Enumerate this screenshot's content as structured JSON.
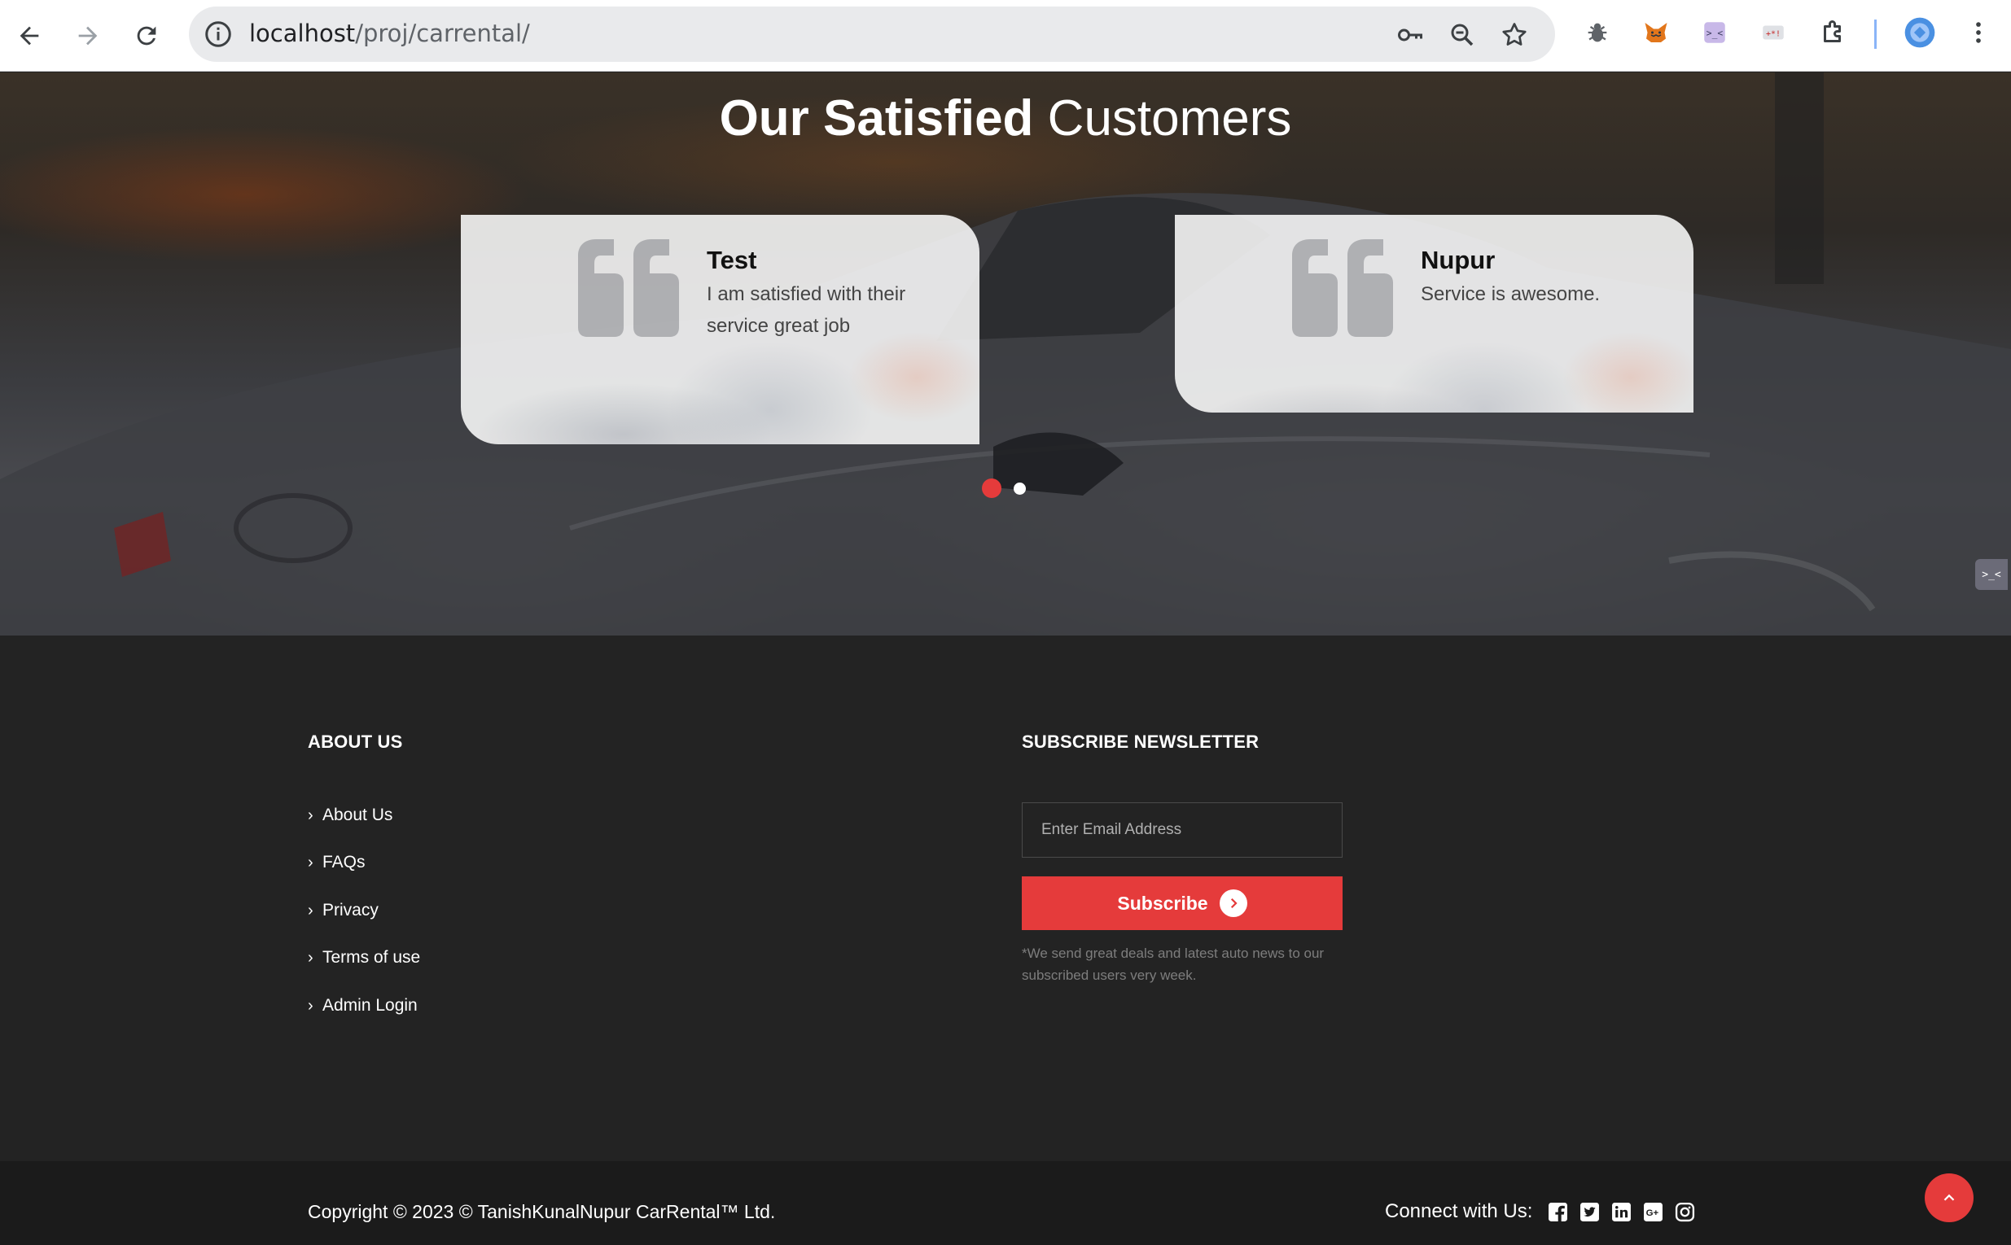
{
  "browser": {
    "url_host": "localhost",
    "url_path": "/proj/carrental/"
  },
  "hero": {
    "title_bold": "Our Satisfied",
    "title_light": "Customers"
  },
  "testimonials": [
    {
      "name": "Test",
      "text": "I am satisfied with their service great job"
    },
    {
      "name": "Nupur",
      "text": "Service is awesome."
    }
  ],
  "carousel": {
    "active_index": 0,
    "count": 2,
    "active_color": "#e53b3b",
    "inactive_color": "#ffffff"
  },
  "side_tab": {
    "label": ">_<"
  },
  "footer": {
    "about": {
      "heading": "ABOUT US",
      "links": [
        "About Us",
        "FAQs",
        "Privacy",
        "Terms of use",
        "Admin Login"
      ]
    },
    "newsletter": {
      "heading": "SUBSCRIBE NEWSLETTER",
      "placeholder": "Enter Email Address",
      "button_label": "Subscribe",
      "note": "*We send great deals and latest auto news to our subscribed users very week."
    },
    "copyright": "Copyright © 2023 © TanishKunalNupur CarRental™ Ltd.",
    "connect_label": "Connect with Us:",
    "social_icons": [
      "facebook-icon",
      "twitter-icon",
      "linkedin-icon",
      "google-plus-icon",
      "instagram-icon"
    ]
  },
  "colors": {
    "accent": "#e53b3b",
    "footer_bg": "#232323",
    "footer_bottom_bg": "#1b1b1b"
  }
}
